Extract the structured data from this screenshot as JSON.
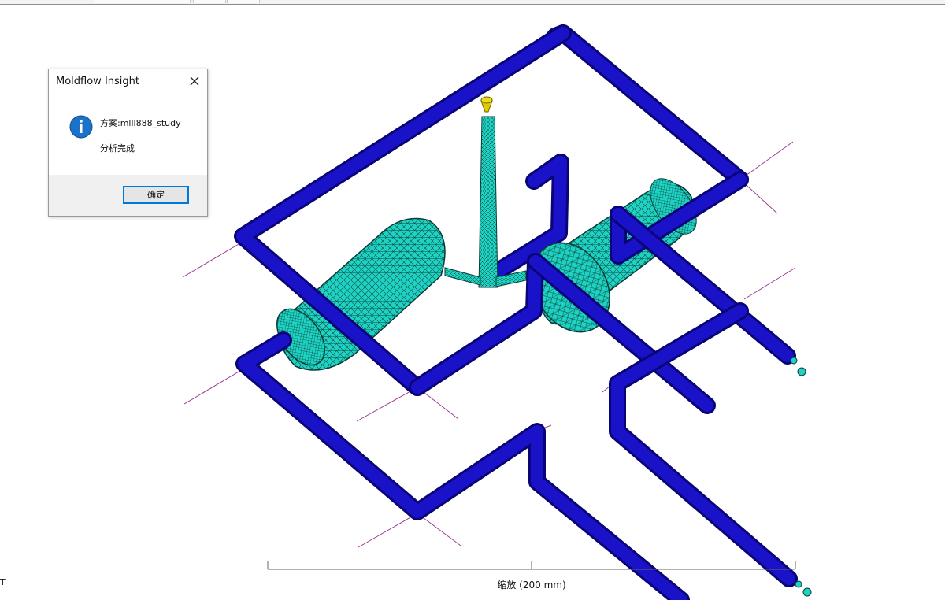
{
  "dialog": {
    "title": "Moldflow Insight",
    "message_line1": "方案:mlll888_study",
    "message_line2": "分析完成",
    "ok_label": "确定"
  },
  "viewport": {
    "scale_label": "缩放 (200 mm)",
    "axis_label": "T"
  },
  "colors": {
    "cooling_channel": "#1a12c8",
    "mesh": "#1ed3c3",
    "mesh_edges": "#0a3a36",
    "injection_point": "#e1cc00",
    "axis_lines": "#9b3d91"
  },
  "icons": {
    "dialog_icon": "info-icon",
    "close": "close-icon"
  }
}
